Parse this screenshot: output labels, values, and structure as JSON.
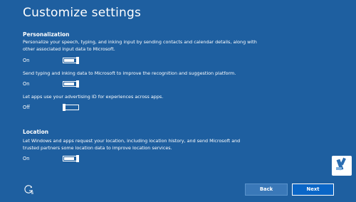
{
  "page": {
    "title": "Customize settings"
  },
  "personalization": {
    "heading": "Personalization",
    "settings": [
      {
        "description": "Personalize your speech, typing, and inking input by sending contacts and calendar details, along with other associated input data to Microsoft.",
        "state_label": "On",
        "enabled": true
      },
      {
        "description": "Send typing and inking data to Microsoft to improve the recognition and suggestion platform.",
        "state_label": "On",
        "enabled": true
      },
      {
        "description": "Let apps use your advertising ID for experiences across apps.",
        "state_label": "Off",
        "enabled": false
      }
    ]
  },
  "location": {
    "heading": "Location",
    "settings": [
      {
        "description": "Let Windows and apps request your location, including location history, and send Microsoft and trusted partners some location data to improve location services.",
        "state_label": "On",
        "enabled": true
      }
    ]
  },
  "footer": {
    "ease_of_access_icon": "ease-of-access-icon",
    "back_label": "Back",
    "next_label": "Next"
  },
  "colors": {
    "background": "#1e5fa0",
    "back_button": "#3a78b8",
    "next_button": "#0a66c7",
    "text": "#ffffff"
  }
}
